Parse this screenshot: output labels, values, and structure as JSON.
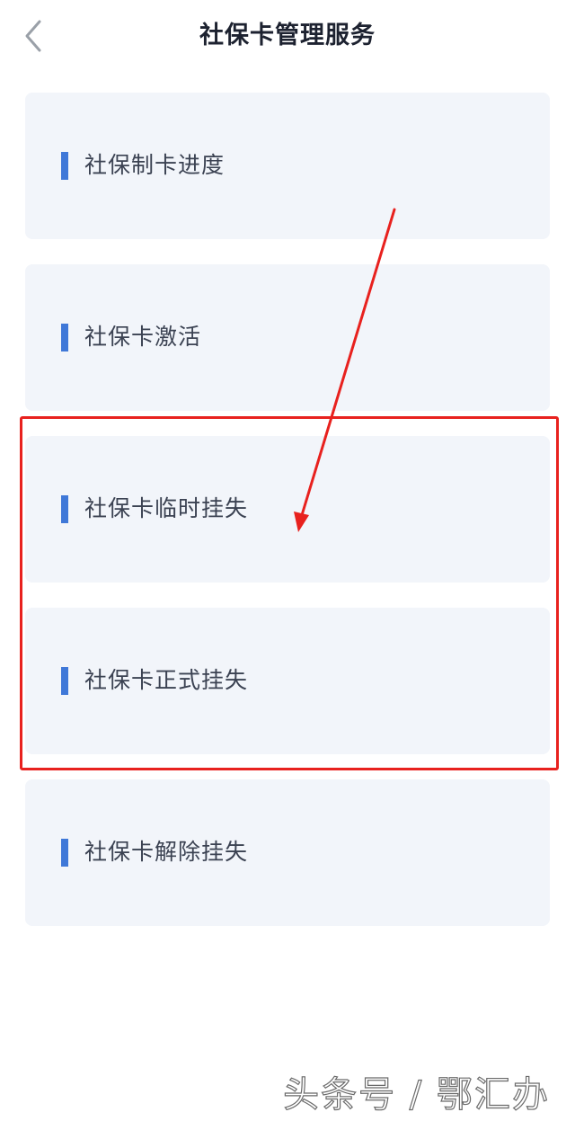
{
  "header": {
    "title": "社保卡管理服务",
    "back_icon": "chevron-left-icon"
  },
  "menu": {
    "items": [
      {
        "label": "社保制卡进度"
      },
      {
        "label": "社保卡激活"
      },
      {
        "label": "社保卡临时挂失"
      },
      {
        "label": "社保卡正式挂失"
      },
      {
        "label": "社保卡解除挂失"
      }
    ]
  },
  "annotation": {
    "highlight_color": "#e8211e",
    "arrow_color": "#e8211e"
  },
  "watermark": {
    "text": "头条号 / 鄂汇办"
  },
  "colors": {
    "accent_bar": "#3f78d8",
    "card_background": "#f2f5fa"
  }
}
